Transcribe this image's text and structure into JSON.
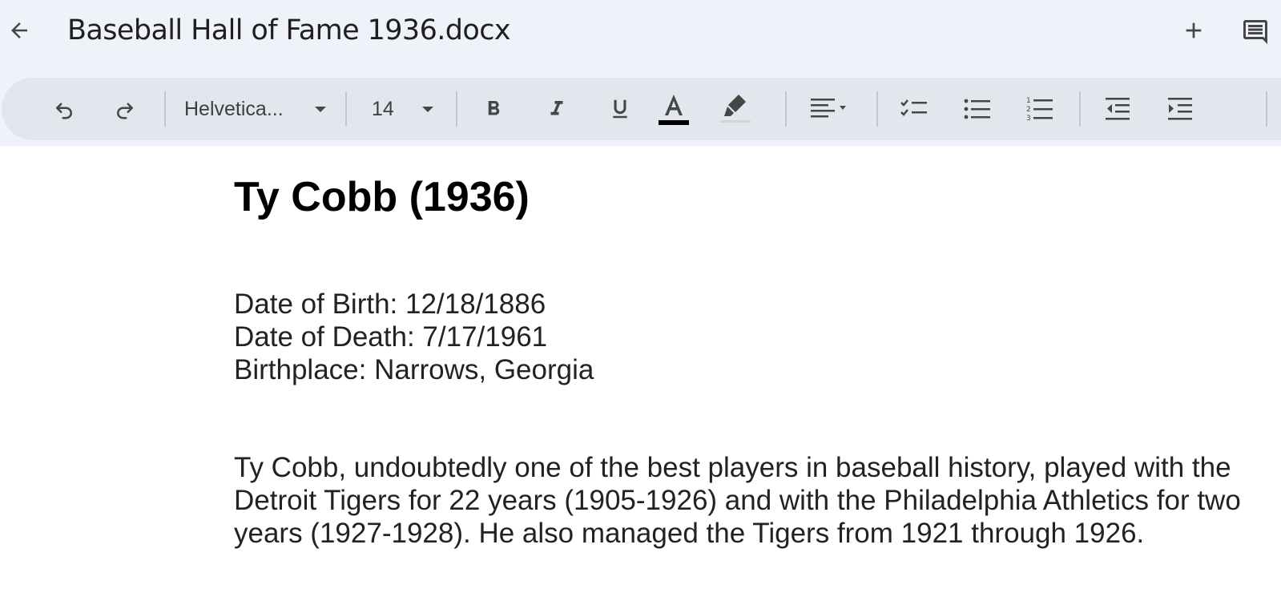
{
  "header": {
    "doc_title": "Baseball Hall of Fame 1936.docx",
    "back_icon": "arrow-back-icon",
    "add_icon": "plus-icon",
    "comment_icon": "comment-icon"
  },
  "toolbar": {
    "font_family": "Helvetica...",
    "font_size": "14",
    "text_color": "#000000",
    "icons": [
      "undo-icon",
      "redo-icon",
      "bold-icon",
      "italic-icon",
      "underline-icon",
      "text-color-icon",
      "highlight-icon",
      "align-left-icon",
      "checklist-icon",
      "bulleted-list-icon",
      "numbered-list-icon",
      "decrease-indent-icon",
      "increase-indent-icon"
    ]
  },
  "document": {
    "heading": "Ty Cobb (1936)",
    "info": [
      "Date of Birth: 12/18/1886",
      "Date of Death: 7/17/1961",
      "Birthplace: Narrows, Georgia"
    ],
    "paragraph": "Ty Cobb, undoubtedly one of the best players in baseball history, played with the Detroit Tigers for 22 years (1905-1926) and with the Philadelphia Athletics for two years (1927-1928). He also managed the Tigers from 1921 through 1926."
  }
}
